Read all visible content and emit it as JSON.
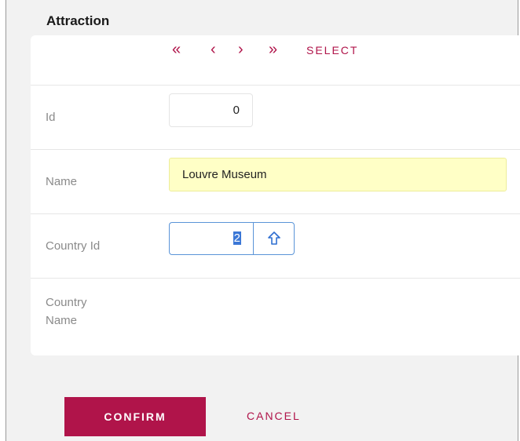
{
  "form": {
    "title": "Attraction",
    "nav": {
      "first_glyph": "«",
      "prev_glyph": "‹",
      "next_glyph": "›",
      "last_glyph": "»",
      "select_label": "SELECT"
    },
    "fields": {
      "id": {
        "label": "Id",
        "value": "0"
      },
      "name": {
        "label": "Name",
        "value": "Louvre Museum"
      },
      "country_id": {
        "label": "Country Id",
        "value": "2"
      },
      "country_name": {
        "label": "Country Name",
        "value": ""
      }
    }
  },
  "actions": {
    "confirm_label": "CONFIRM",
    "cancel_label": "CANCEL"
  },
  "colors": {
    "accent": "#b0144a",
    "focus_border": "#5a94d8",
    "readonly_bg": "#ffffc6",
    "icon_blue": "#2f6fd1"
  },
  "icons": {
    "prompt": "arrow-up-outline-icon"
  }
}
